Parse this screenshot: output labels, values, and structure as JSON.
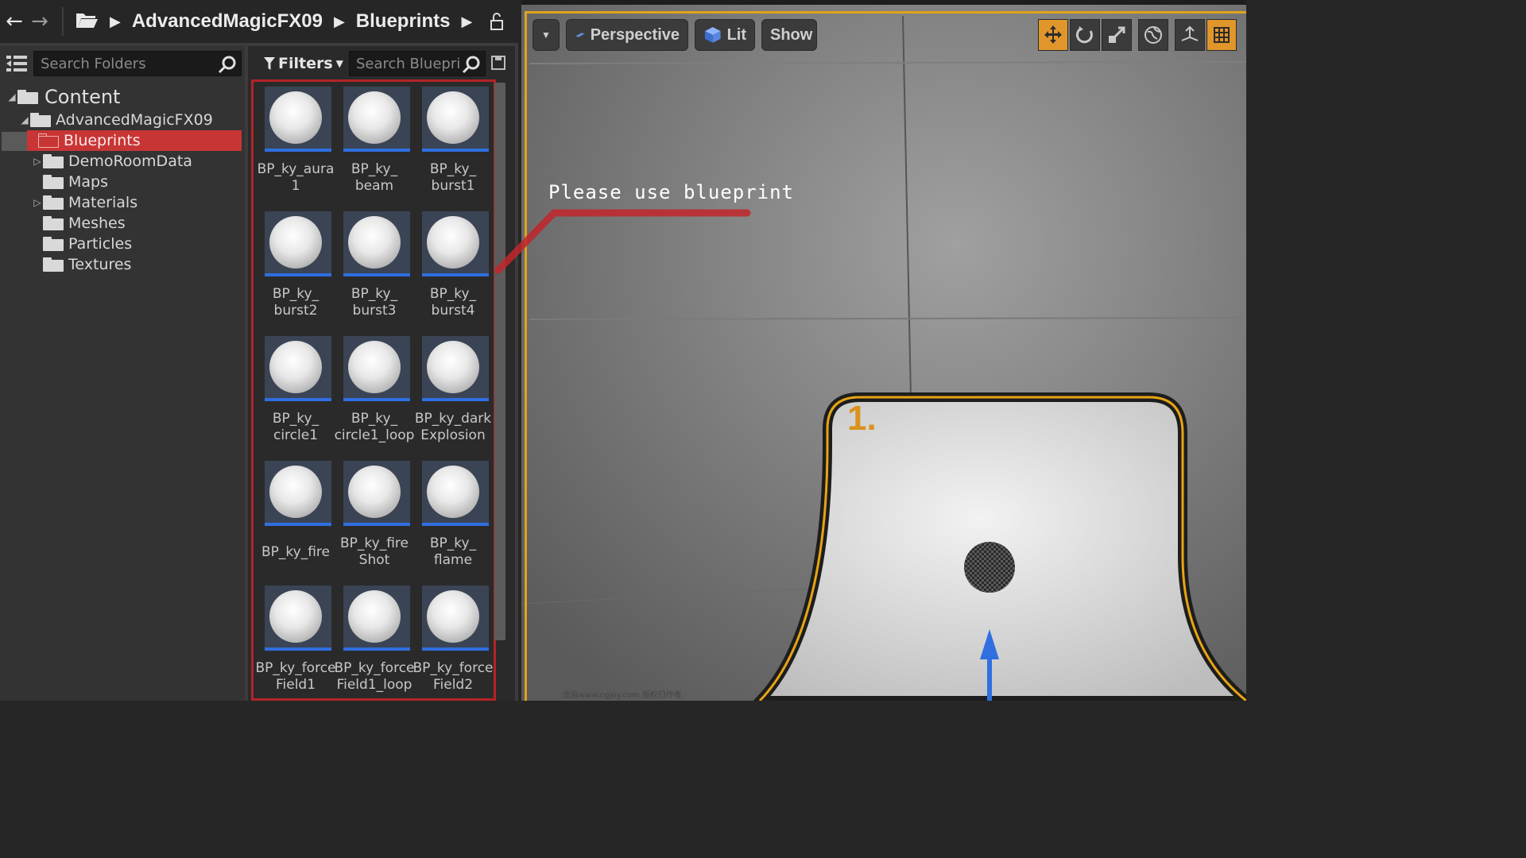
{
  "browser": {
    "breadcrumb": [
      "AdvancedMagicFX09",
      "Blueprints"
    ],
    "folder_search_placeholder": "Search Folders",
    "asset_search_placeholder": "Search Bluepri",
    "filters_label": "Filters",
    "tree": [
      {
        "label": "Content",
        "level": 0,
        "expandable": true,
        "expanded": true
      },
      {
        "label": "AdvancedMagicFX09",
        "level": 1,
        "expandable": true,
        "expanded": true
      },
      {
        "label": "Blueprints",
        "level": 2,
        "selected": true
      },
      {
        "label": "DemoRoomData",
        "level": 2,
        "expandable": true
      },
      {
        "label": "Maps",
        "level": 2
      },
      {
        "label": "Materials",
        "level": 2,
        "expandable": true
      },
      {
        "label": "Meshes",
        "level": 2
      },
      {
        "label": "Particles",
        "level": 2
      },
      {
        "label": "Textures",
        "level": 2
      }
    ],
    "assets": [
      [
        "BP_ky_aura",
        "1"
      ],
      [
        "BP_ky_",
        "beam"
      ],
      [
        "BP_ky_",
        "burst1"
      ],
      [
        "BP_ky_",
        "burst2"
      ],
      [
        "BP_ky_",
        "burst3"
      ],
      [
        "BP_ky_",
        "burst4"
      ],
      [
        "BP_ky_",
        "circle1"
      ],
      [
        "BP_ky_",
        "circle1_loop"
      ],
      [
        "BP_ky_dark",
        "Explosion"
      ],
      [
        "BP_ky_fire",
        ""
      ],
      [
        "BP_ky_fire",
        "Shot"
      ],
      [
        "BP_ky_",
        "flame"
      ],
      [
        "BP_ky_force",
        "Field1"
      ],
      [
        "BP_ky_force",
        "Field1_loop"
      ],
      [
        "BP_ky_force",
        "Field2"
      ]
    ]
  },
  "viewport": {
    "perspective_label": "Perspective",
    "lit_label": "Lit",
    "show_label": "Show",
    "callout": "Please use blueprint",
    "sign": "1.",
    "watermark": "出自www.cgjoy.com 版权归作者"
  },
  "colors": {
    "accent": "#e1a21a",
    "selection": "#c83535",
    "asset_bar": "#2f6fe0"
  }
}
